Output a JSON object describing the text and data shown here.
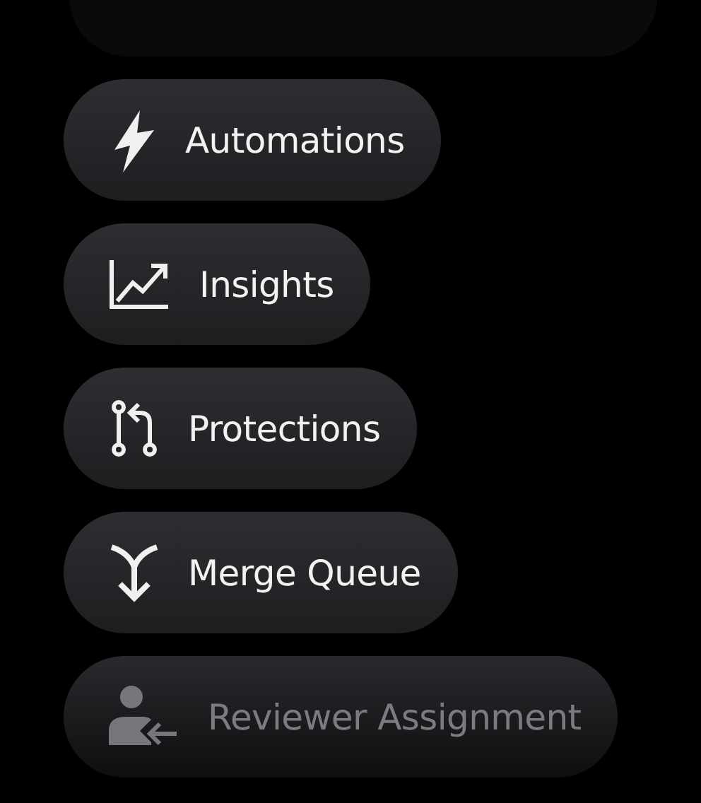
{
  "menu_items": [
    {
      "kind": "bolt",
      "label": "Automations",
      "faded": false
    },
    {
      "kind": "chart",
      "label": "Insights",
      "faded": false
    },
    {
      "kind": "branch",
      "label": "Protections",
      "faded": false
    },
    {
      "kind": "merge",
      "label": "Merge Queue",
      "faded": false
    },
    {
      "kind": "reviewer",
      "label": "Reviewer Assignment",
      "faded": true
    }
  ]
}
